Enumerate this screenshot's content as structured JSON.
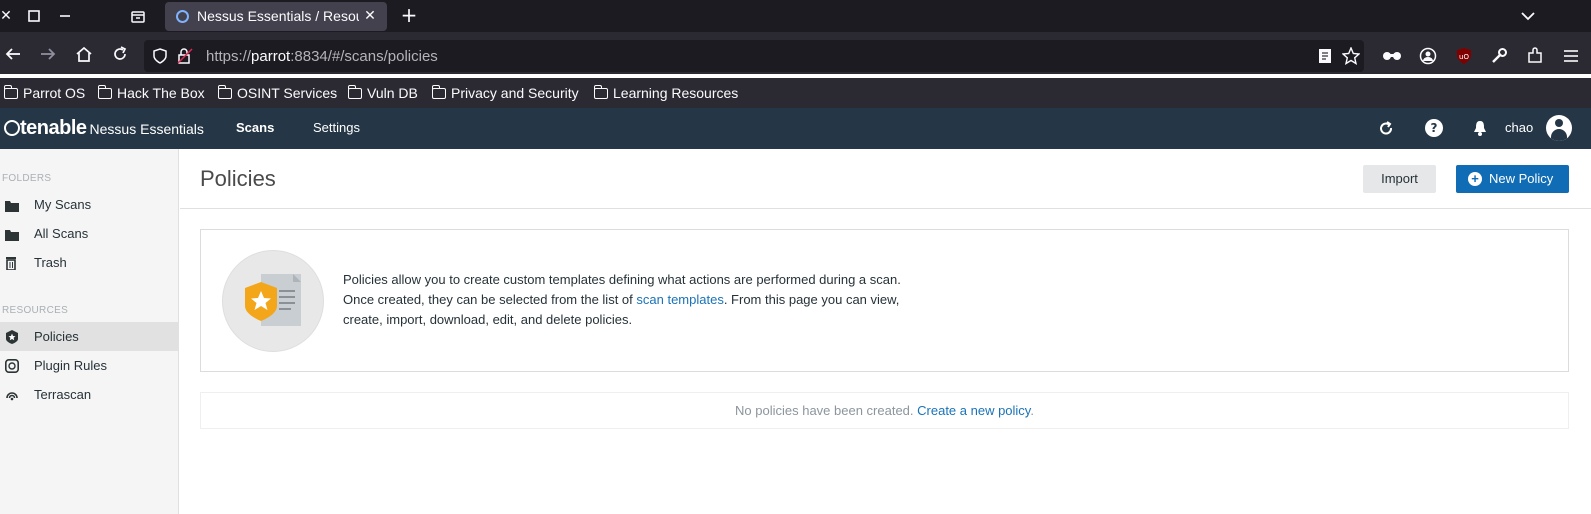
{
  "browser": {
    "tab_title": "Nessus Essentials / Resources / Policies",
    "url_prefix": "https://",
    "url_host": "parrot",
    "url_rest": ":8834/#/scans/policies",
    "bookmarks": [
      "Parrot OS",
      "Hack The Box",
      "OSINT Services",
      "Vuln DB",
      "Privacy and Security",
      "Learning Resources"
    ]
  },
  "header": {
    "logo_brand": "tenable",
    "logo_product": "Nessus Essentials",
    "nav": [
      "Scans",
      "Settings"
    ],
    "user": "chao"
  },
  "sidebar": {
    "folders_heading": "FOLDERS",
    "folders": [
      "My Scans",
      "All Scans",
      "Trash"
    ],
    "resources_heading": "RESOURCES",
    "resources": [
      "Policies",
      "Plugin Rules",
      "Terrascan"
    ]
  },
  "main": {
    "title": "Policies",
    "import_label": "Import",
    "new_policy_label": "New Policy",
    "info_line1": "Policies allow you to create custom templates defining what actions are performed during a scan.",
    "info_line2_pre": "Once created, they can be selected from the list of ",
    "info_link": "scan templates",
    "info_line2_post": ". From this page you can view,",
    "info_line3": "create, import, download, edit, and delete policies.",
    "empty_text": "No policies have been created. ",
    "empty_link": "Create a new policy",
    "empty_period": "."
  },
  "colors": {
    "app_header": "#253746",
    "primary_button": "#0f6cb5",
    "link": "#1a73b8"
  }
}
